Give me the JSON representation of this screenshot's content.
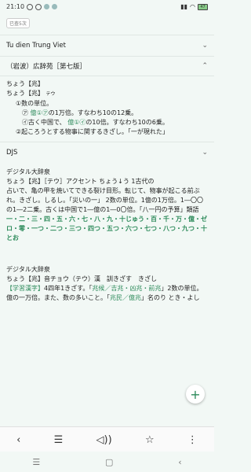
{
  "status_bar": {
    "time": "21:10",
    "battery": "47"
  },
  "badge": "已查5次",
  "dictionary_sections": [
    {
      "title": "Tu dien Trung Viet",
      "expanded": false
    },
    {
      "title": "DJS",
      "expanded": false
    }
  ],
  "koujien": {
    "title": "（岩波）広辞苑［第七版］",
    "head1": "ちょう【兆】",
    "head2": "ちょう【兆】",
    "head2_kana": "テウ",
    "sense1": "①数の単位。",
    "sense1a_prefix": "㋐",
    "sense1a_hl": "億①㋐",
    "sense1a_suffix": "の1万倍。すなわち10の12乗。",
    "sense1b_prefix": "㋑古く中国で、",
    "sense1b_hl": "億①㋑",
    "sense1b_suffix": "の10倍。すなわち10の6乗。",
    "sense2": "②起ころうとする物事に関するきざし。「一が現れた」"
  },
  "digital1": {
    "source": "デジタル大辞泉",
    "line1": "ちょう【兆】［テウ］アクセント ちょう↓う",
    "img_alt": "1古代の",
    "body": "占いで、亀の甲を焼いてできる裂け目形。転じて、物事が起こる前ぶれ。きざし。しるし。「災いの一」 2数の単位。1億の1万倍。1―〇〇の1―2二乗。古くは中国で1―億の1―0〇倍。「八一円の予算」類語",
    "green": "一・二・三・四・五・六・七・八・九・十じゅう・百・千・万・億・ゼロ・零・一つ・二つ・三つ・四つ・五つ・六つ・七つ・八つ・九つ・十とお"
  },
  "digital2": {
    "source": "デジタル大辞泉",
    "line1": "ちょう【兆】音チョウ（テウ）漢　訓きざす　きざし",
    "grade_link": "【学習漢字】",
    "grade_text": "4四年1きざす。「",
    "link1": "兆候／吉兆・凶兆・前兆",
    "mid": "」2数の単位。億の一万倍。また、数の多いこと。「",
    "link2": "兆民／億兆",
    "tail": "」名のり とき・よし"
  },
  "toolbar": {
    "back": "‹",
    "list": "☰",
    "audio": "◁))",
    "star": "☆",
    "more": "⋮"
  },
  "navbar": {
    "menu": "☰",
    "home": "▢",
    "back": "‹"
  },
  "fab_label": "+"
}
